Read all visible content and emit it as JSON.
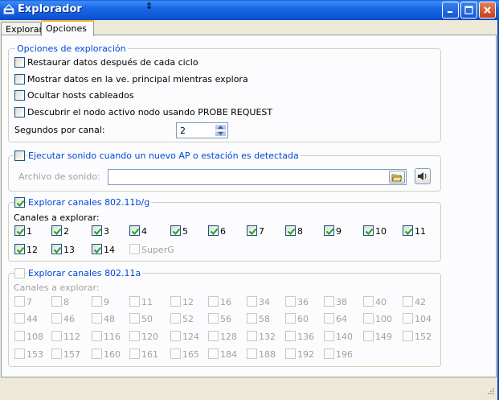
{
  "window": {
    "title": "Explorador"
  },
  "tabs": [
    {
      "label": "Explorar",
      "active": false
    },
    {
      "label": "Opciones",
      "active": true
    }
  ],
  "exploration": {
    "legend": "Opciones de exploración",
    "options": [
      {
        "label": "Restaurar datos después de cada ciclo",
        "checked": false
      },
      {
        "label": "Mostrar datos en la ve. principal mientras explora",
        "checked": false
      },
      {
        "label": "Ocultar hosts cableados",
        "checked": false
      },
      {
        "label": "Descubrir el nodo activo nodo usando PROBE REQUEST",
        "checked": false
      }
    ],
    "seconds_label": "Segundos por canal:",
    "seconds_value": "2"
  },
  "sound": {
    "legend": "Ejecutar sonido cuando un nuevo AP o estación es detectada",
    "checked": false,
    "file_label": "Archivo de sonido:",
    "file_value": ""
  },
  "bg": {
    "legend": "Explorar canales 802.11b/g",
    "checked": true,
    "channels_label": "Canales a explorar:",
    "channels": [
      "1",
      "2",
      "3",
      "4",
      "5",
      "6",
      "7",
      "8",
      "9",
      "10",
      "11",
      "12",
      "13",
      "14",
      "SuperG"
    ],
    "checked_channels": [
      true,
      true,
      true,
      true,
      true,
      true,
      true,
      true,
      true,
      true,
      true,
      true,
      true,
      true,
      false
    ]
  },
  "a": {
    "legend": "Explorar canales 802.11a",
    "checked": false,
    "channels_label": "Canales a explorar:",
    "channels": [
      "7",
      "8",
      "9",
      "11",
      "12",
      "16",
      "34",
      "36",
      "38",
      "40",
      "42",
      "44",
      "46",
      "48",
      "50",
      "52",
      "56",
      "58",
      "60",
      "64",
      "100",
      "104",
      "108",
      "112",
      "116",
      "120",
      "124",
      "128",
      "132",
      "136",
      "140",
      "149",
      "152",
      "153",
      "157",
      "160",
      "161",
      "165",
      "184",
      "188",
      "192",
      "196"
    ]
  }
}
